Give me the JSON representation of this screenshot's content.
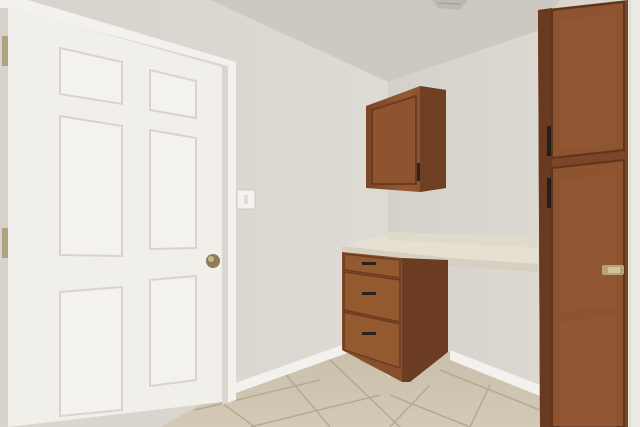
{
  "scene": {
    "description_name": "laundry-room-interior",
    "colors": {
      "wall": "#dcd8d2",
      "wall_shadow": "#c9c5bf",
      "ceiling": "#cfcbc5",
      "door": "#f1efea",
      "door_panel_shadow": "#dedbd5",
      "cabinet_wood": "#8a5230",
      "cabinet_wood_dark": "#6b3d22",
      "countertop": "#e6e0d3",
      "floor_tile": "#cbc0ad",
      "grout": "#b3a892",
      "baseboard": "#f2f0ec",
      "knob": "#9a8a66"
    },
    "icons": [
      "door-knob-icon",
      "light-switch-icon",
      "cabinet-handle-icon",
      "ceiling-vent-icon"
    ]
  }
}
